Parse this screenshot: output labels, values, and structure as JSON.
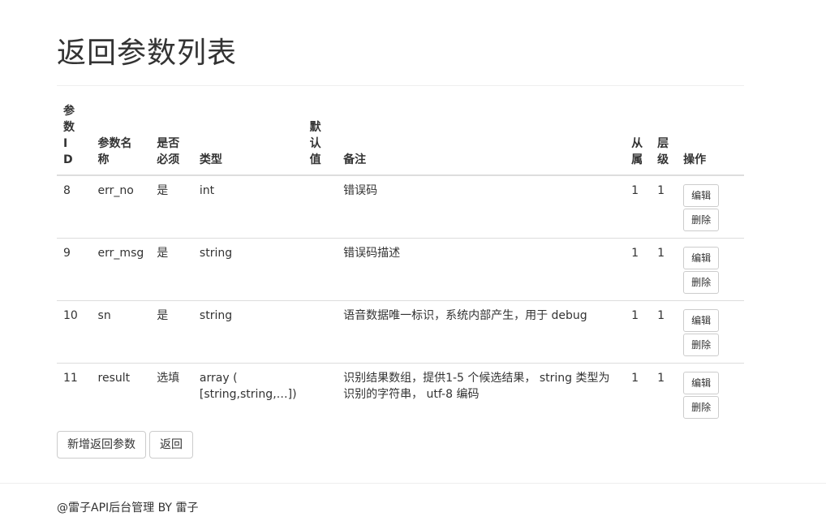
{
  "page": {
    "title": "返回参数列表"
  },
  "table": {
    "headers": {
      "id": "参数ID",
      "name": "参数名称",
      "required": "是否必须",
      "type": "类型",
      "default": "默认值",
      "note": "备注",
      "from": "从属",
      "level": "层级",
      "op": "操作"
    },
    "rows": [
      {
        "id": "8",
        "name": "err_no",
        "required": "是",
        "type": "int",
        "default": "",
        "note": "错误码",
        "from": "1",
        "level": "1"
      },
      {
        "id": "9",
        "name": "err_msg",
        "required": "是",
        "type": "string",
        "default": "",
        "note": "错误码描述",
        "from": "1",
        "level": "1"
      },
      {
        "id": "10",
        "name": "sn",
        "required": "是",
        "type": "string",
        "default": "",
        "note": "语音数据唯一标识，系统内部产生，用于 debug",
        "from": "1",
        "level": "1"
      },
      {
        "id": "11",
        "name": "result",
        "required": "选填",
        "type": "array ( [string,string,…])",
        "default": "",
        "note": "识别结果数组，提供1-5 个候选结果， string 类型为识别的字符串， utf-8 编码",
        "from": "1",
        "level": "1"
      }
    ],
    "edit_label": "编辑",
    "delete_label": "删除"
  },
  "actions": {
    "add_label": "新增返回参数",
    "back_label": "返回"
  },
  "footer": {
    "text": "@雷子API后台管理 BY 雷子"
  }
}
